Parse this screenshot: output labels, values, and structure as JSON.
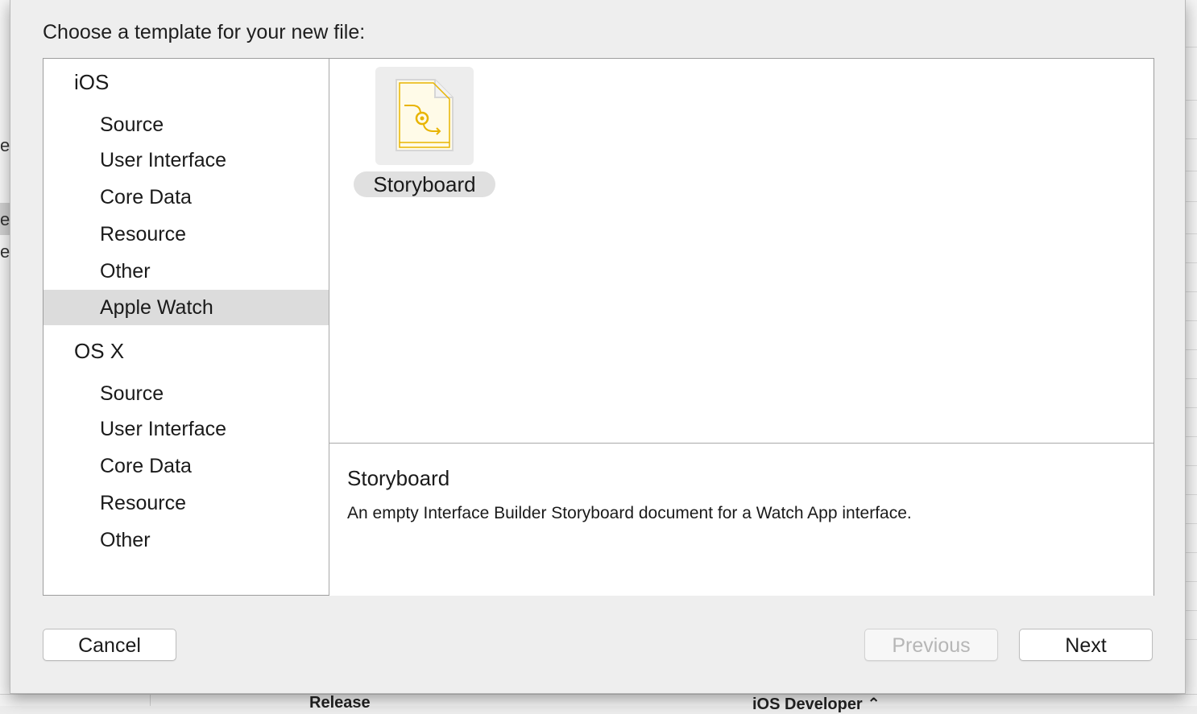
{
  "dialog": {
    "prompt": "Choose a template for your new file:"
  },
  "sidebar": {
    "groups": [
      {
        "header": "iOS",
        "items": [
          "Source",
          "User Interface",
          "Core Data",
          "Resource",
          "Other",
          "Apple Watch"
        ]
      },
      {
        "header": "OS X",
        "items": [
          "Source",
          "User Interface",
          "Core Data",
          "Resource",
          "Other"
        ]
      }
    ],
    "selected": "Apple Watch"
  },
  "templates": [
    {
      "label": "Storyboard",
      "icon": "storyboard-file-icon"
    }
  ],
  "description": {
    "title": "Storyboard",
    "text": "An empty Interface Builder Storyboard document for a Watch App interface."
  },
  "buttons": {
    "cancel": "Cancel",
    "previous": "Previous",
    "next": "Next"
  },
  "background": {
    "left_letters": [
      "e",
      "e",
      "e"
    ],
    "bottom_left": "Release",
    "bottom_right": "iOS Developer ⌃"
  },
  "colors": {
    "selection": "#dcdcdc",
    "icon_accent": "#e8b400"
  }
}
